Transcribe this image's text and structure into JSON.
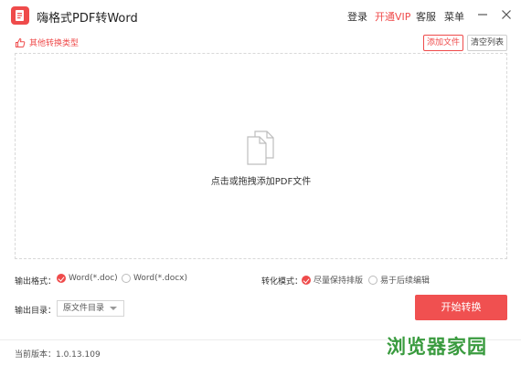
{
  "app": {
    "title": "嗨格式PDF转Word",
    "logo_color": "#ef4b4b"
  },
  "topnav": {
    "login": "登录",
    "vip": "开通VIP",
    "service": "客服",
    "menu": "菜单"
  },
  "toolbar": {
    "other_types": "其他转换类型",
    "add_file": "添加文件",
    "clear_list": "清空列表"
  },
  "dropzone": {
    "text": "点击或拖拽添加PDF文件"
  },
  "output_format": {
    "label": "输出格式：",
    "options": [
      "Word(*.doc)",
      "Word(*.docx)"
    ],
    "selected": "Word(*.doc)"
  },
  "convert_mode": {
    "label": "转化模式：",
    "options": [
      "尽量保持排版",
      "易于后续编辑"
    ],
    "selected": "尽量保持排版"
  },
  "output_dir": {
    "label": "输出目录：",
    "value": "原文件目录"
  },
  "start_button": "开始转换",
  "footer": {
    "version": "当前版本：1.0.13.109"
  },
  "watermark": "浏览器家园",
  "colors": {
    "accent": "#ef4b4b",
    "watermark": "#3a9b3f"
  }
}
